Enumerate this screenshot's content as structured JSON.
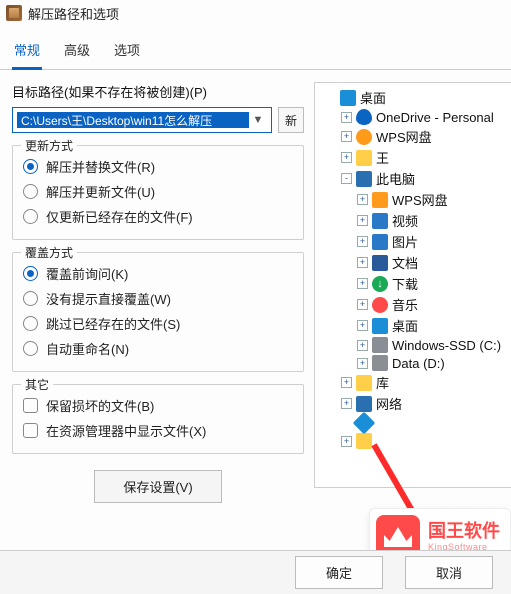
{
  "window": {
    "title": "解压路径和选项"
  },
  "tabs": {
    "general": "常规",
    "advanced": "高级",
    "options": "选项",
    "active": 0
  },
  "path": {
    "label": "目标路径(如果不存在将被创建)(P)",
    "value": "C:\\Users\\王\\Desktop\\win11怎么解压",
    "new_btn": "新"
  },
  "groups": {
    "update": {
      "title": "更新方式",
      "opts": [
        {
          "label": "解压并替换文件(R)",
          "selected": true
        },
        {
          "label": "解压并更新文件(U)",
          "selected": false
        },
        {
          "label": "仅更新已经存在的文件(F)",
          "selected": false
        }
      ]
    },
    "overwrite": {
      "title": "覆盖方式",
      "opts": [
        {
          "label": "覆盖前询问(K)",
          "selected": true
        },
        {
          "label": "没有提示直接覆盖(W)",
          "selected": false
        },
        {
          "label": "跳过已经存在的文件(S)",
          "selected": false
        },
        {
          "label": "自动重命名(N)",
          "selected": false
        }
      ]
    },
    "other": {
      "title": "其它",
      "opts": [
        {
          "label": "保留损坏的文件(B)",
          "checked": false
        },
        {
          "label": "在资源管理器中显示文件(X)",
          "checked": false
        }
      ]
    }
  },
  "save_btn": "保存设置(V)",
  "tree": [
    {
      "ind": 0,
      "exp": "",
      "icon": "i-desktop",
      "label": "桌面"
    },
    {
      "ind": 1,
      "exp": "+",
      "icon": "i-onedrive",
      "label": "OneDrive - Personal"
    },
    {
      "ind": 1,
      "exp": "+",
      "icon": "i-wps",
      "label": "WPS网盘"
    },
    {
      "ind": 1,
      "exp": "+",
      "icon": "i-folder",
      "label": "王"
    },
    {
      "ind": 1,
      "exp": "-",
      "icon": "i-pc",
      "label": "此电脑"
    },
    {
      "ind": 2,
      "exp": "+",
      "icon": "i-wpsf",
      "label": "WPS网盘"
    },
    {
      "ind": 2,
      "exp": "+",
      "icon": "i-video",
      "label": "视频"
    },
    {
      "ind": 2,
      "exp": "+",
      "icon": "i-pic",
      "label": "图片"
    },
    {
      "ind": 2,
      "exp": "+",
      "icon": "i-doc",
      "label": "文档"
    },
    {
      "ind": 2,
      "exp": "+",
      "icon": "i-dl",
      "label": "下载"
    },
    {
      "ind": 2,
      "exp": "+",
      "icon": "i-music",
      "label": "音乐"
    },
    {
      "ind": 2,
      "exp": "+",
      "icon": "i-desktop",
      "label": "桌面"
    },
    {
      "ind": 2,
      "exp": "+",
      "icon": "i-drive",
      "label": "Windows-SSD (C:)"
    },
    {
      "ind": 2,
      "exp": "+",
      "icon": "i-drive",
      "label": "Data (D:)"
    },
    {
      "ind": 1,
      "exp": "+",
      "icon": "i-lib",
      "label": "库"
    },
    {
      "ind": 1,
      "exp": "+",
      "icon": "i-net",
      "label": "网络"
    },
    {
      "ind": 1,
      "exp": "",
      "icon": "i-blue",
      "label": ""
    },
    {
      "ind": 1,
      "exp": "+",
      "icon": "i-folder",
      "label": ""
    }
  ],
  "footer": {
    "ok": "确定",
    "cancel": "取消"
  },
  "watermark": {
    "zh": "国王软件",
    "en": "KingSoftware"
  }
}
